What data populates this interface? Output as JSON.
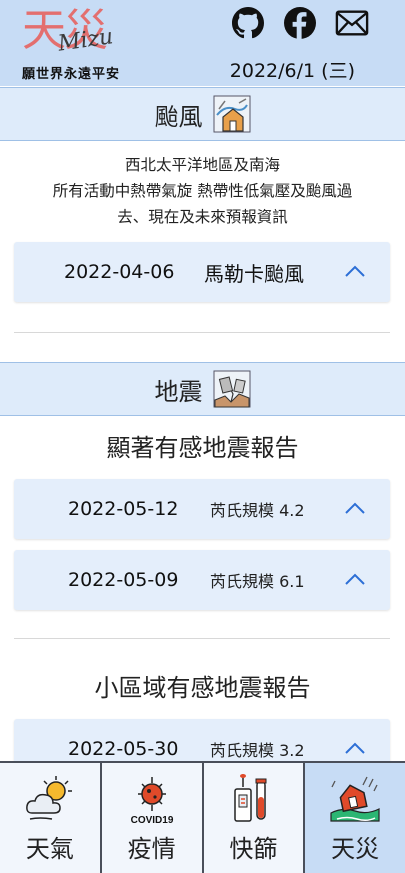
{
  "header": {
    "logo_big": "天災",
    "logo_script": "Mizu",
    "logo_sub": "願世界永遠平安",
    "date": "2022/6/1 (三)",
    "social": [
      "github-icon",
      "facebook-icon",
      "mail-icon"
    ]
  },
  "typhoon": {
    "title": "颱風",
    "desc_lines": [
      "西北太平洋地區及南海",
      "所有活動中熱帶氣旋 熱帶性低氣壓及颱風過",
      "去、現在及未來預報資訊"
    ],
    "item": {
      "date": "2022-04-06",
      "name": "馬勒卡颱風"
    }
  },
  "quake": {
    "title": "地震",
    "felt_title": "顯著有感地震報告",
    "felt": [
      {
        "date": "2022-05-12",
        "mag": "芮氏規模 4.2"
      },
      {
        "date": "2022-05-09",
        "mag": "芮氏規模 6.1"
      }
    ],
    "local_title": "小區域有感地震報告",
    "local": [
      {
        "date": "2022-05-30",
        "mag": "芮氏規模 3.2"
      }
    ]
  },
  "nav": {
    "tabs": [
      {
        "label": "天氣",
        "icon": "weather-icon"
      },
      {
        "label": "疫情",
        "icon": "covid19-icon",
        "icon_text": "COVID19"
      },
      {
        "label": "快篩",
        "icon": "rapid-test-icon"
      },
      {
        "label": "天災",
        "icon": "disaster-icon"
      }
    ]
  },
  "colors": {
    "header_bg": "#c7dcf5",
    "section_bg": "#deebfa",
    "card_bg": "#e4eefb",
    "accent": "#2d6fd6",
    "logo_red": "#e36f6f"
  }
}
